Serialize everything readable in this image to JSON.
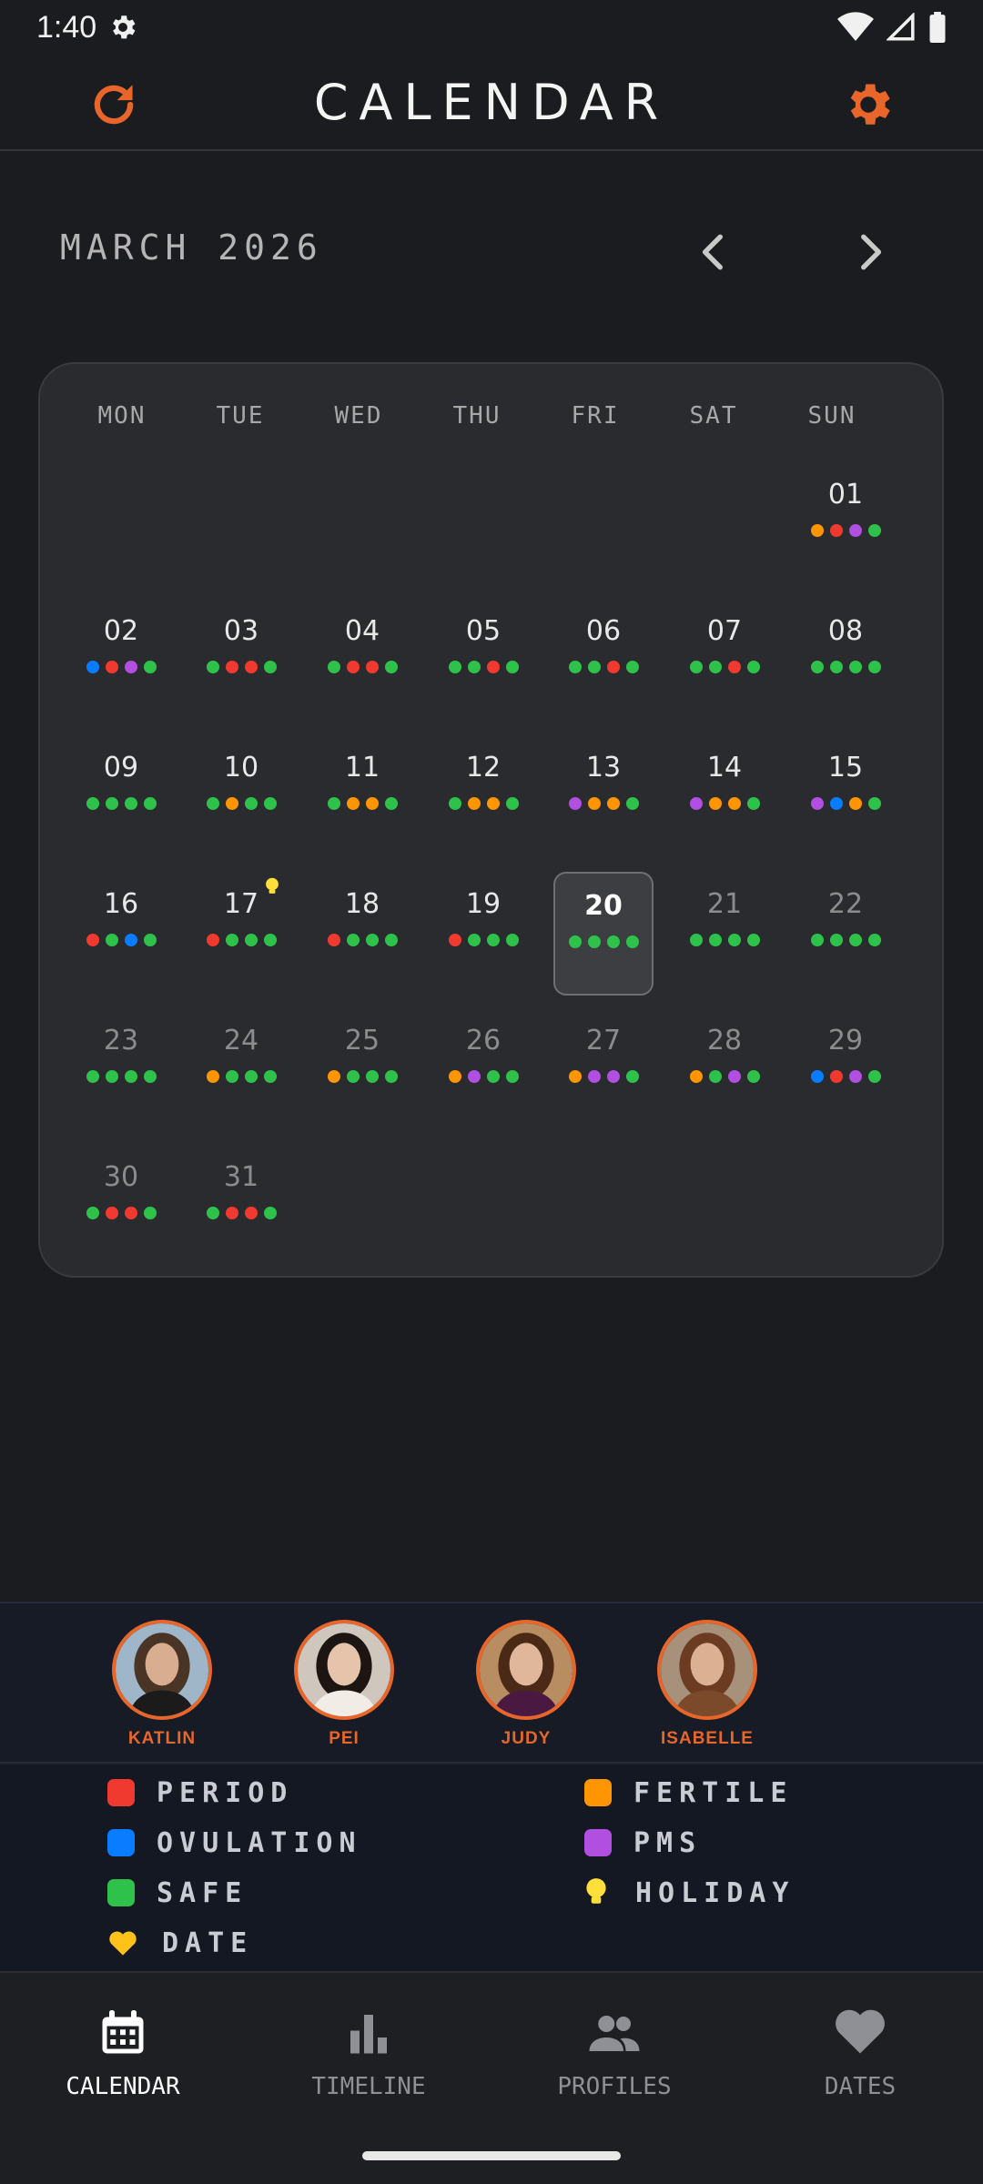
{
  "status_bar": {
    "time": "1:40"
  },
  "app_bar": {
    "title": "CALENDAR"
  },
  "month": {
    "label": "MARCH 2026"
  },
  "weekdays": [
    "MON",
    "TUE",
    "WED",
    "THU",
    "FRI",
    "SAT",
    "SUN"
  ],
  "colors": {
    "period": "#f03a2f",
    "fertile": "#ff9500",
    "ovulation": "#0a7cff",
    "pms": "#b04fe0",
    "safe": "#2ec24b",
    "holiday": "#ffe03a",
    "date": "#ffc21a",
    "accent": "#e8662a"
  },
  "days": [
    {
      "num": "01",
      "dots": [
        "fertile",
        "period",
        "pms",
        "safe"
      ]
    },
    {
      "num": "02",
      "dots": [
        "ovulation",
        "period",
        "pms",
        "safe"
      ]
    },
    {
      "num": "03",
      "dots": [
        "safe",
        "period",
        "period",
        "safe"
      ]
    },
    {
      "num": "04",
      "dots": [
        "safe",
        "period",
        "period",
        "safe"
      ]
    },
    {
      "num": "05",
      "dots": [
        "safe",
        "safe",
        "period",
        "safe"
      ]
    },
    {
      "num": "06",
      "dots": [
        "safe",
        "safe",
        "period",
        "safe"
      ]
    },
    {
      "num": "07",
      "dots": [
        "safe",
        "safe",
        "period",
        "safe"
      ]
    },
    {
      "num": "08",
      "dots": [
        "safe",
        "safe",
        "safe",
        "safe"
      ]
    },
    {
      "num": "09",
      "dots": [
        "safe",
        "safe",
        "safe",
        "safe"
      ]
    },
    {
      "num": "10",
      "dots": [
        "safe",
        "fertile",
        "safe",
        "safe"
      ]
    },
    {
      "num": "11",
      "dots": [
        "safe",
        "fertile",
        "fertile",
        "safe"
      ]
    },
    {
      "num": "12",
      "dots": [
        "safe",
        "fertile",
        "fertile",
        "safe"
      ]
    },
    {
      "num": "13",
      "dots": [
        "pms",
        "fertile",
        "fertile",
        "safe"
      ]
    },
    {
      "num": "14",
      "dots": [
        "pms",
        "fertile",
        "fertile",
        "safe"
      ]
    },
    {
      "num": "15",
      "dots": [
        "pms",
        "ovulation",
        "fertile",
        "safe"
      ]
    },
    {
      "num": "16",
      "dots": [
        "period",
        "safe",
        "ovulation",
        "safe"
      ]
    },
    {
      "num": "17",
      "dots": [
        "period",
        "safe",
        "safe",
        "safe"
      ],
      "holiday": true
    },
    {
      "num": "18",
      "dots": [
        "period",
        "safe",
        "safe",
        "safe"
      ]
    },
    {
      "num": "19",
      "dots": [
        "period",
        "safe",
        "safe",
        "safe"
      ]
    },
    {
      "num": "20",
      "dots": [
        "safe",
        "safe",
        "safe",
        "safe"
      ],
      "today": true
    },
    {
      "num": "21",
      "dots": [
        "safe",
        "safe",
        "safe",
        "safe"
      ],
      "future": true
    },
    {
      "num": "22",
      "dots": [
        "safe",
        "safe",
        "safe",
        "safe"
      ],
      "future": true
    },
    {
      "num": "23",
      "dots": [
        "safe",
        "safe",
        "safe",
        "safe"
      ],
      "future": true
    },
    {
      "num": "24",
      "dots": [
        "fertile",
        "safe",
        "safe",
        "safe"
      ],
      "future": true
    },
    {
      "num": "25",
      "dots": [
        "fertile",
        "safe",
        "safe",
        "safe"
      ],
      "future": true
    },
    {
      "num": "26",
      "dots": [
        "fertile",
        "pms",
        "safe",
        "safe"
      ],
      "future": true
    },
    {
      "num": "27",
      "dots": [
        "fertile",
        "pms",
        "pms",
        "safe"
      ],
      "future": true
    },
    {
      "num": "28",
      "dots": [
        "fertile",
        "safe",
        "pms",
        "safe"
      ],
      "future": true
    },
    {
      "num": "29",
      "dots": [
        "ovulation",
        "period",
        "pms",
        "safe"
      ],
      "future": true
    },
    {
      "num": "30",
      "dots": [
        "safe",
        "period",
        "period",
        "safe"
      ],
      "future": true
    },
    {
      "num": "31",
      "dots": [
        "safe",
        "period",
        "period",
        "safe"
      ],
      "future": true
    }
  ],
  "profiles": [
    {
      "name": "KATLIN"
    },
    {
      "name": "PEI"
    },
    {
      "name": "JUDY"
    },
    {
      "name": "ISABELLE"
    }
  ],
  "legend": [
    {
      "key": "period",
      "label": "PERIOD"
    },
    {
      "key": "fertile",
      "label": "FERTILE"
    },
    {
      "key": "ovulation",
      "label": "OVULATION"
    },
    {
      "key": "pms",
      "label": "PMS"
    },
    {
      "key": "safe",
      "label": "SAFE"
    },
    {
      "key": "holiday",
      "label": "HOLIDAY"
    },
    {
      "key": "date",
      "label": "DATE"
    }
  ],
  "bottom_nav": [
    {
      "label": "CALENDAR",
      "icon": "calendar-icon",
      "active": true
    },
    {
      "label": "TIMELINE",
      "icon": "bar-chart-icon",
      "active": false
    },
    {
      "label": "PROFILES",
      "icon": "people-icon",
      "active": false
    },
    {
      "label": "DATES",
      "icon": "heart-icon",
      "active": false
    }
  ]
}
